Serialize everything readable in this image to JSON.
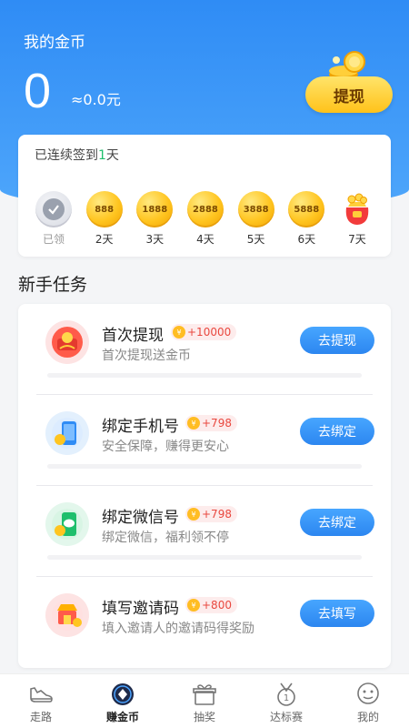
{
  "header": {
    "title": "我的金币",
    "coin_amount": "0",
    "coin_cny": "≈0.0元",
    "withdraw_label": "提现"
  },
  "checkin": {
    "prefix": "已连续签到",
    "days_count": "1",
    "suffix": "天",
    "days": [
      {
        "label": "已领",
        "value": "",
        "status": "claimed"
      },
      {
        "label": "2天",
        "value": "888",
        "status": "pending"
      },
      {
        "label": "3天",
        "value": "1888",
        "status": "pending"
      },
      {
        "label": "4天",
        "value": "2888",
        "status": "pending"
      },
      {
        "label": "5天",
        "value": "3888",
        "status": "pending"
      },
      {
        "label": "6天",
        "value": "5888",
        "status": "pending"
      },
      {
        "label": "7天",
        "value": "",
        "status": "gift"
      }
    ]
  },
  "tasks": {
    "section_title": "新手任务",
    "items": [
      {
        "name": "首次提现",
        "reward": "+10000",
        "desc": "首次提现送金币",
        "button": "去提现",
        "icon": "withdraw-gift-icon"
      },
      {
        "name": "绑定手机号",
        "reward": "+798",
        "desc": "安全保障，赚得更安心",
        "button": "去绑定",
        "icon": "phone-icon"
      },
      {
        "name": "绑定微信号",
        "reward": "+798",
        "desc": "绑定微信，福利领不停",
        "button": "去绑定",
        "icon": "wechat-icon"
      },
      {
        "name": "填写邀请码",
        "reward": "+800",
        "desc": "填入邀请人的邀请码得奖励",
        "button": "去填写",
        "icon": "invite-shop-icon"
      }
    ]
  },
  "tabbar": {
    "items": [
      {
        "label": "走路",
        "icon": "shoe-icon",
        "active": false
      },
      {
        "label": "赚金币",
        "icon": "diamond-coin-icon",
        "active": true
      },
      {
        "label": "抽奖",
        "icon": "gift-box-icon",
        "active": false
      },
      {
        "label": "达标赛",
        "icon": "medal-icon",
        "active": false
      },
      {
        "label": "我的",
        "icon": "profile-face-icon",
        "active": false
      }
    ]
  },
  "colors": {
    "primary_blue": "#2f8cf5",
    "accent_gold": "#ffc21a",
    "reward_red": "#e9483f",
    "streak_green": "#1fbf6c"
  }
}
